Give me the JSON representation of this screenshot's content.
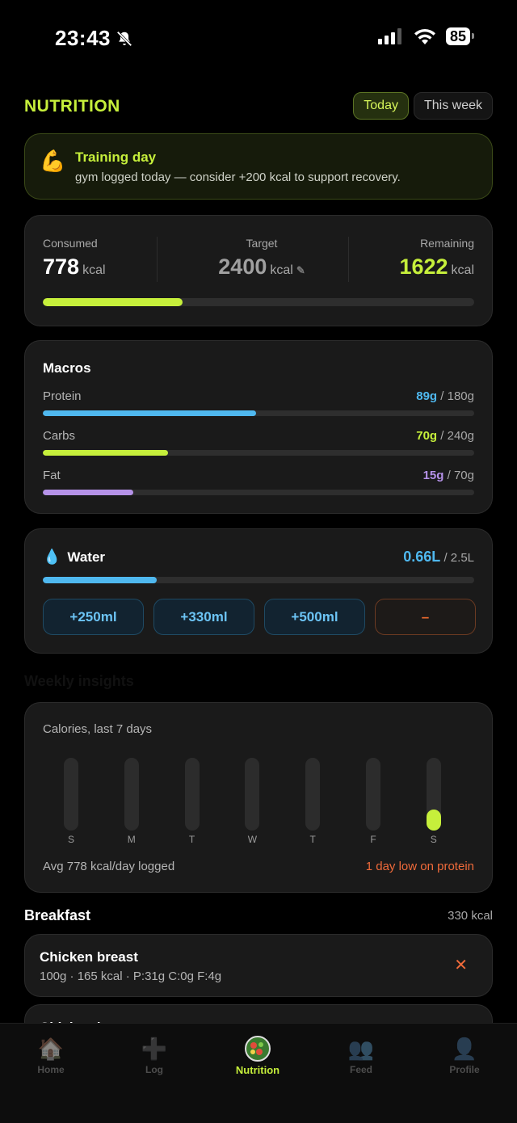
{
  "status_bar": {
    "time": "23:43",
    "battery": "85",
    "icons": [
      "bell-slash-icon",
      "signal-icon",
      "wifi-icon",
      "battery-icon"
    ]
  },
  "header": {
    "title": "NUTRITION",
    "tabs": [
      {
        "label": "Today",
        "active": true
      },
      {
        "label": "This week",
        "active": false
      }
    ]
  },
  "banner": {
    "icon": "flexed-biceps-icon",
    "title": "Training day",
    "text": "gym logged today — consider +200 kcal to support recovery."
  },
  "calories": {
    "consumed_label": "Consumed",
    "consumed_value": "778",
    "consumed_unit": "kcal",
    "target_label": "Target",
    "target_value": "2400",
    "target_unit": "kcal",
    "target_edit_icon": "pencil-icon",
    "remaining_label": "Remaining",
    "remaining_value": "1622",
    "remaining_unit": "kcal",
    "progress": 0.324
  },
  "macros": {
    "title": "Macros",
    "items": [
      {
        "label": "Protein",
        "value": "89g",
        "target": "/ 180g",
        "progress": 0.494,
        "color": "#4fb8ef"
      },
      {
        "label": "Carbs",
        "value": "70g",
        "target": "/ 240g",
        "progress": 0.29,
        "color": "#c6ef3b"
      },
      {
        "label": "Fat",
        "value": "15g",
        "target": "/ 70g",
        "progress": 0.21,
        "color": "#b592e8"
      }
    ]
  },
  "water": {
    "icon": "water-drop-icon",
    "title": "Water",
    "value": "0.66L",
    "target": "/ 2.5L",
    "progress": 0.264,
    "buttons": [
      "+250ml",
      "+330ml",
      "+500ml",
      "–"
    ]
  },
  "weekly": {
    "heading": "Weekly insights",
    "chart_title": "Calories, last 7 days",
    "footer_left": "Avg 778 kcal/day logged",
    "footer_right": "1 day low on protein"
  },
  "chart_data": {
    "type": "bar",
    "categories": [
      "S",
      "M",
      "T",
      "W",
      "T",
      "F",
      "S"
    ],
    "values": [
      0,
      0,
      0,
      0,
      0,
      0,
      778
    ],
    "title": "Calories, last 7 days",
    "xlabel": "",
    "ylabel": "",
    "ylim": [
      0,
      2400
    ],
    "grid": false
  },
  "meal": {
    "title": "Breakfast",
    "kcal": "330 kcal",
    "items": [
      {
        "name": "Chicken breast",
        "detail": "100g · 165 kcal · P:31g C:0g F:4g",
        "remove_icon": "close-icon"
      },
      {
        "name": "Chicken breast"
      }
    ]
  },
  "tabbar": [
    {
      "label": "Home",
      "icon": "house-icon",
      "glyph": "🏠",
      "active": false
    },
    {
      "label": "Log",
      "icon": "plus-icon",
      "glyph": "➕",
      "active": false
    },
    {
      "label": "Nutrition",
      "icon": "salad-icon",
      "glyph": "",
      "active": true
    },
    {
      "label": "Feed",
      "icon": "people-icon",
      "glyph": "👥",
      "active": false
    },
    {
      "label": "Profile",
      "icon": "person-icon",
      "glyph": "👤",
      "active": false
    }
  ]
}
